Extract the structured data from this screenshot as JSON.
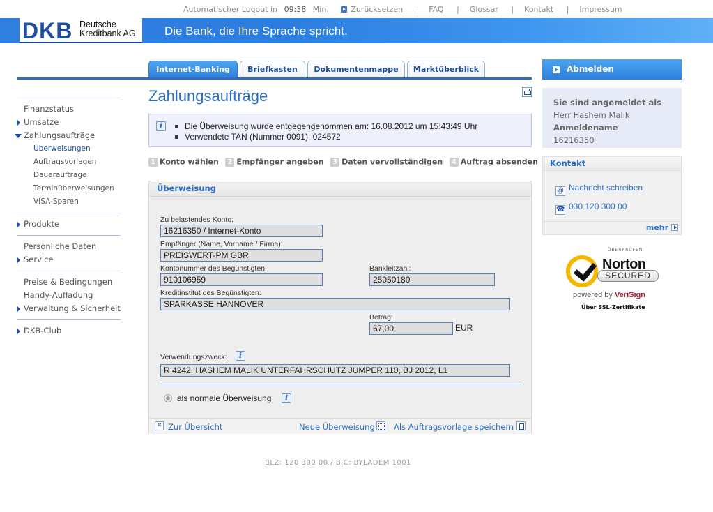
{
  "util": {
    "logout_text": "Automatischer Logout in",
    "logout_time": "09:38",
    "logout_unit": "Min.",
    "reset": "Zurücksetzen",
    "links": [
      "FAQ",
      "Glossar",
      "Kontakt",
      "Impressum"
    ]
  },
  "header": {
    "logo": "DKB",
    "logo_sub_1": "Deutsche",
    "logo_sub_2": "Kreditbank AG",
    "slogan": "Die Bank, die Ihre Sprache spricht."
  },
  "tabs": [
    {
      "label": "Internet-Banking",
      "active": true
    },
    {
      "label": "Briefkasten",
      "active": false
    },
    {
      "label": "Dokumentenmappe",
      "active": false
    },
    {
      "label": "Marktüberblick",
      "active": false
    }
  ],
  "logout_button": "Abmelden",
  "nav": {
    "finanzstatus": "Finanzstatus",
    "umsaetze": "Umsätze",
    "zahlungsauftraege": "Zahlungsaufträge",
    "sub": [
      "Überweisungen",
      "Auftragsvorlagen",
      "Daueraufträge",
      "Terminüberweisungen",
      "VISA-Sparen"
    ],
    "produkte": "Produkte",
    "persoenliche_daten": "Persönliche Daten",
    "service": "Service",
    "preise": "Preise & Bedingungen",
    "handy": "Handy-Aufladung",
    "verwaltung": "Verwaltung & Sicherheit",
    "club": "DKB-Club"
  },
  "page_title": "Zahlungsaufträge",
  "info": {
    "line1": "Die Überweisung wurde entgegengenommen am: 16.08.2012 um 15:43:49 Uhr",
    "line2": "Verwendete TAN (Nummer 0091): 024572"
  },
  "steps": [
    {
      "num": "1",
      "label": "Konto wählen"
    },
    {
      "num": "2",
      "label": "Empfänger angeben"
    },
    {
      "num": "3",
      "label": "Daten vervollständigen"
    },
    {
      "num": "4",
      "label": "Auftrag absenden"
    }
  ],
  "form": {
    "panel_title": "Überweisung",
    "konto_label": "Zu belastendes Konto:",
    "konto_value": "16216350 / Internet-Konto",
    "empfaenger_label": "Empfänger (Name, Vorname / Firma):",
    "empfaenger_value": "PREISWERT-PM GBR",
    "kontonummer_label": "Kontonummer des Begünstigten:",
    "kontonummer_value": "910106959",
    "blz_label": "Bankleitzahl:",
    "blz_value": "25050180",
    "institut_label": "Kreditinstitut des Begünstigten:",
    "institut_value": "SPARKASSE HANNOVER",
    "betrag_label": "Betrag:",
    "betrag_value": "67,00",
    "currency": "EUR",
    "zweck_label": "Verwendungszweck:",
    "zweck_value": "R 4242, HASHEM MALIK UNTERFAHRSCHUTZ JUMPER 110, BJ 2012, L1",
    "radio_label": "als normale Überweisung"
  },
  "footer_links": {
    "back": "Zur Übersicht",
    "new": "Neue Überweisung",
    "save": "Als Auftragsvorlage speichern"
  },
  "user": {
    "logged_in_label": "Sie sind angemeldet als",
    "name": "Herr Hashem Malik",
    "login_label": "Anmeldename",
    "login_value": "16216350"
  },
  "contact": {
    "title": "Kontakt",
    "message": "Nachricht schreiben",
    "phone": "030 120 300 00",
    "more": "mehr"
  },
  "norton": {
    "top": "ÜBERPRÜFEN",
    "brand": "Norton",
    "secured": "SECURED",
    "powered_by": "powered by",
    "verisign": "VeriSign",
    "ssl": "Über SSL-Zertifikate"
  },
  "bottom": "BLZ: 120 300 00 / BIC: BYLADEM 1001",
  "colors": {
    "primary": "#2c6fc5",
    "dark_blue": "#1b4d9c",
    "header_gradient_start": "#2f7fe0"
  }
}
